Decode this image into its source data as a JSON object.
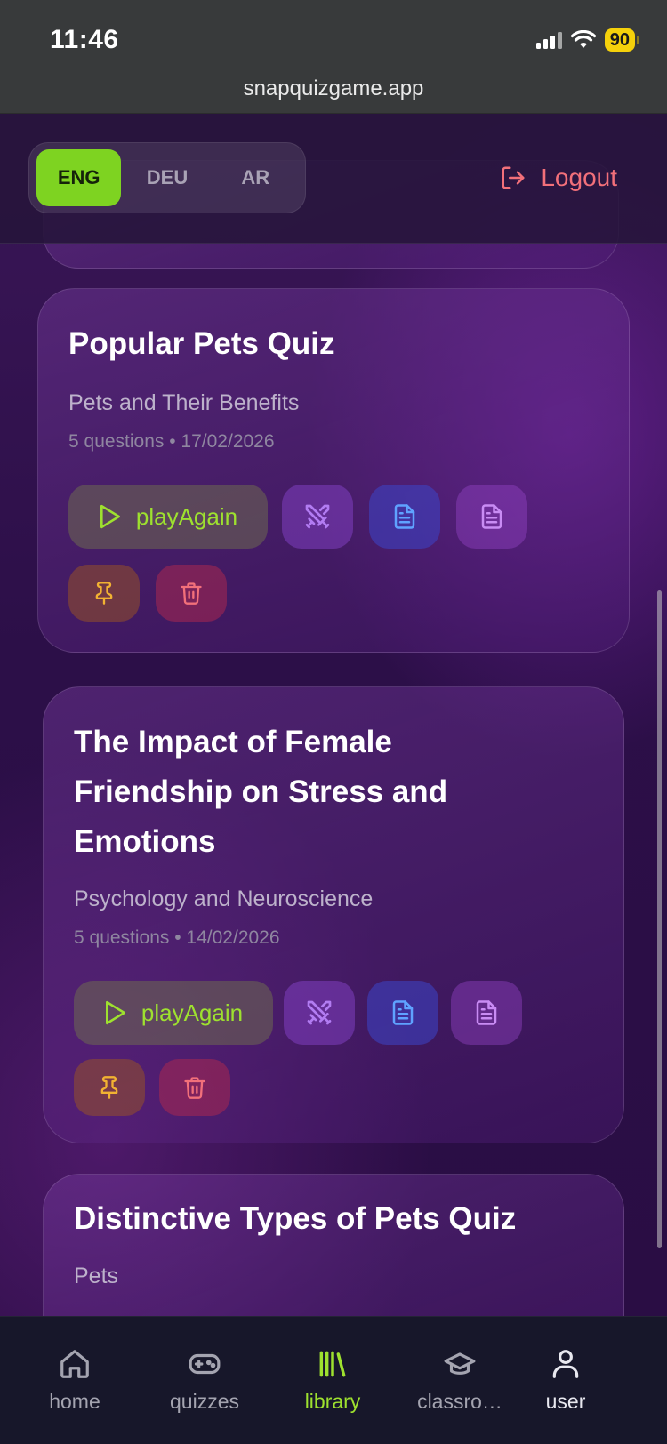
{
  "status_bar": {
    "time": "11:46",
    "battery": "90"
  },
  "browser": {
    "url": "snapquizgame.app"
  },
  "header": {
    "languages": [
      {
        "label": "ENG",
        "active": true
      },
      {
        "label": "DEU",
        "active": false
      },
      {
        "label": "AR",
        "active": false
      }
    ],
    "logout_label": "Logout"
  },
  "quizzes": [
    {
      "title": "Popular Pets Quiz",
      "topic": "Pets and Their Benefits",
      "meta": "5 questions • 17/02/2026",
      "play_label": "playAgain"
    },
    {
      "title_lines": [
        "The Impact of Female",
        "Friendship on Stress and",
        "Emotions"
      ],
      "topic": "Psychology and Neuroscience",
      "meta": "5 questions • 14/02/2026",
      "play_label": "playAgain"
    },
    {
      "title": "Distinctive Types of Pets Quiz",
      "topic": "Pets"
    }
  ],
  "bottom_nav": {
    "items": [
      {
        "label": "home",
        "icon": "home-icon"
      },
      {
        "label": "quizzes",
        "icon": "gamepad-icon"
      },
      {
        "label": "library",
        "icon": "library-icon",
        "active": true
      },
      {
        "label": "classro…",
        "icon": "graduation-cap-icon"
      },
      {
        "label": "user",
        "icon": "user-icon"
      }
    ]
  },
  "colors": {
    "accent_green": "#7ed321",
    "logout_red": "#f2707a",
    "active_nav": "#9ee12f"
  }
}
